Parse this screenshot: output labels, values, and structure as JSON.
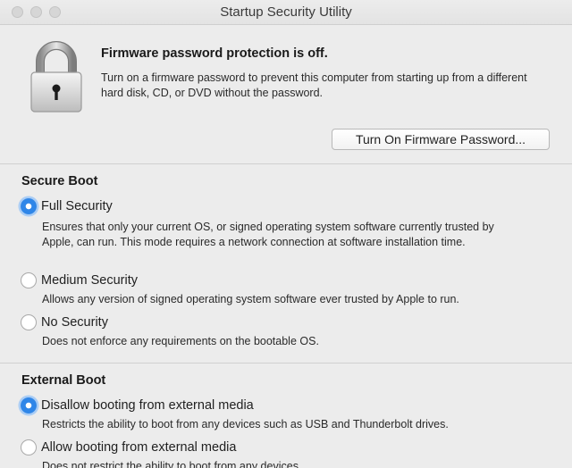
{
  "window": {
    "title": "Startup Security Utility"
  },
  "firmware": {
    "heading": "Firmware password protection is off.",
    "description": "Turn on a firmware password to prevent this computer from starting up from a different hard disk, CD, or DVD without the password.",
    "button_label": "Turn On Firmware Password...",
    "icon": "lock-icon"
  },
  "secure_boot": {
    "title": "Secure Boot",
    "options": [
      {
        "label": "Full Security",
        "selected": true,
        "description": "Ensures that only your current OS, or signed operating system software currently trusted by Apple, can run. This mode requires a network connection at software installation time."
      },
      {
        "label": "Medium Security",
        "selected": false,
        "description": "Allows any version of signed operating system software ever trusted by Apple to run."
      },
      {
        "label": "No Security",
        "selected": false,
        "description": "Does not enforce any requirements on the bootable OS."
      }
    ]
  },
  "external_boot": {
    "title": "External Boot",
    "options": [
      {
        "label": "Disallow booting from external media",
        "selected": true,
        "description": "Restricts the ability to boot from any devices such as USB and Thunderbolt drives."
      },
      {
        "label": "Allow booting from external media",
        "selected": false,
        "description": "Does not restrict the ability to boot from any devices."
      }
    ]
  },
  "colors": {
    "accent": "#2f86e8",
    "background": "#ececec"
  }
}
